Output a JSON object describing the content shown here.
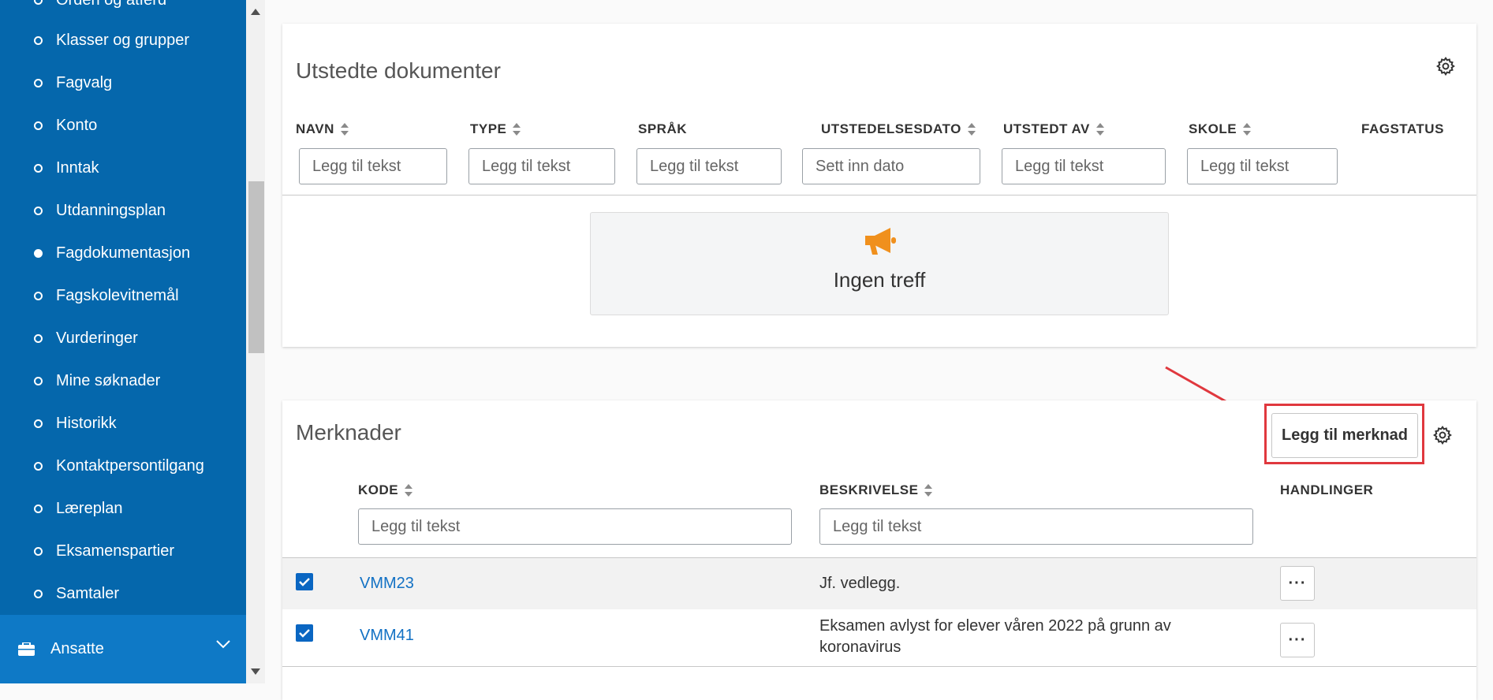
{
  "sidebar": {
    "items": [
      {
        "label": "Orden og atferd",
        "active": false
      },
      {
        "label": "Klasser og grupper",
        "active": false
      },
      {
        "label": "Fagvalg",
        "active": false
      },
      {
        "label": "Konto",
        "active": false
      },
      {
        "label": "Inntak",
        "active": false
      },
      {
        "label": "Utdanningsplan",
        "active": false
      },
      {
        "label": "Fagdokumentasjon",
        "active": true
      },
      {
        "label": "Fagskolevitnemål",
        "active": false
      },
      {
        "label": "Vurderinger",
        "active": false
      },
      {
        "label": "Mine søknader",
        "active": false
      },
      {
        "label": "Historikk",
        "active": false
      },
      {
        "label": "Kontaktpersontilgang",
        "active": false
      },
      {
        "label": "Læreplan",
        "active": false
      },
      {
        "label": "Eksamenspartier",
        "active": false
      },
      {
        "label": "Samtaler",
        "active": false
      }
    ],
    "section": {
      "label": "Ansatte",
      "icon": "briefcase-icon"
    }
  },
  "docs": {
    "title": "Utstedte dokumenter",
    "columns": [
      {
        "label": "NAVN",
        "placeholder": "Legg til tekst"
      },
      {
        "label": "TYPE",
        "placeholder": "Legg til tekst"
      },
      {
        "label": "SPRÅK",
        "placeholder": "Legg til tekst"
      },
      {
        "label": "UTSTEDELSESDATO",
        "placeholder": "Sett inn dato"
      },
      {
        "label": "UTSTEDT AV",
        "placeholder": "Legg til tekst"
      },
      {
        "label": "SKOLE",
        "placeholder": "Legg til tekst"
      },
      {
        "label": "FAGSTATUS"
      }
    ],
    "empty_text": "Ingen treff",
    "empty_icon": "megaphone-icon"
  },
  "notes": {
    "title": "Merknader",
    "add_label": "Legg til merknad",
    "columns": [
      {
        "label": "KODE",
        "placeholder": "Legg til tekst"
      },
      {
        "label": "BESKRIVELSE",
        "placeholder": "Legg til tekst"
      },
      {
        "label": "HANDLINGER"
      }
    ],
    "rows": [
      {
        "code": "VMM23",
        "description": "Jf. vedlegg.",
        "checked": true,
        "more": "···"
      },
      {
        "code": "VMM41",
        "description": "Eksamen avlyst for elever våren 2022 på grunn av koronavirus",
        "checked": true,
        "more": "···"
      }
    ]
  },
  "colors": {
    "sidebar": "#0567ac",
    "accent": "#0a66c2",
    "megaphone": "#f0901d",
    "highlight": "#e0383e"
  }
}
